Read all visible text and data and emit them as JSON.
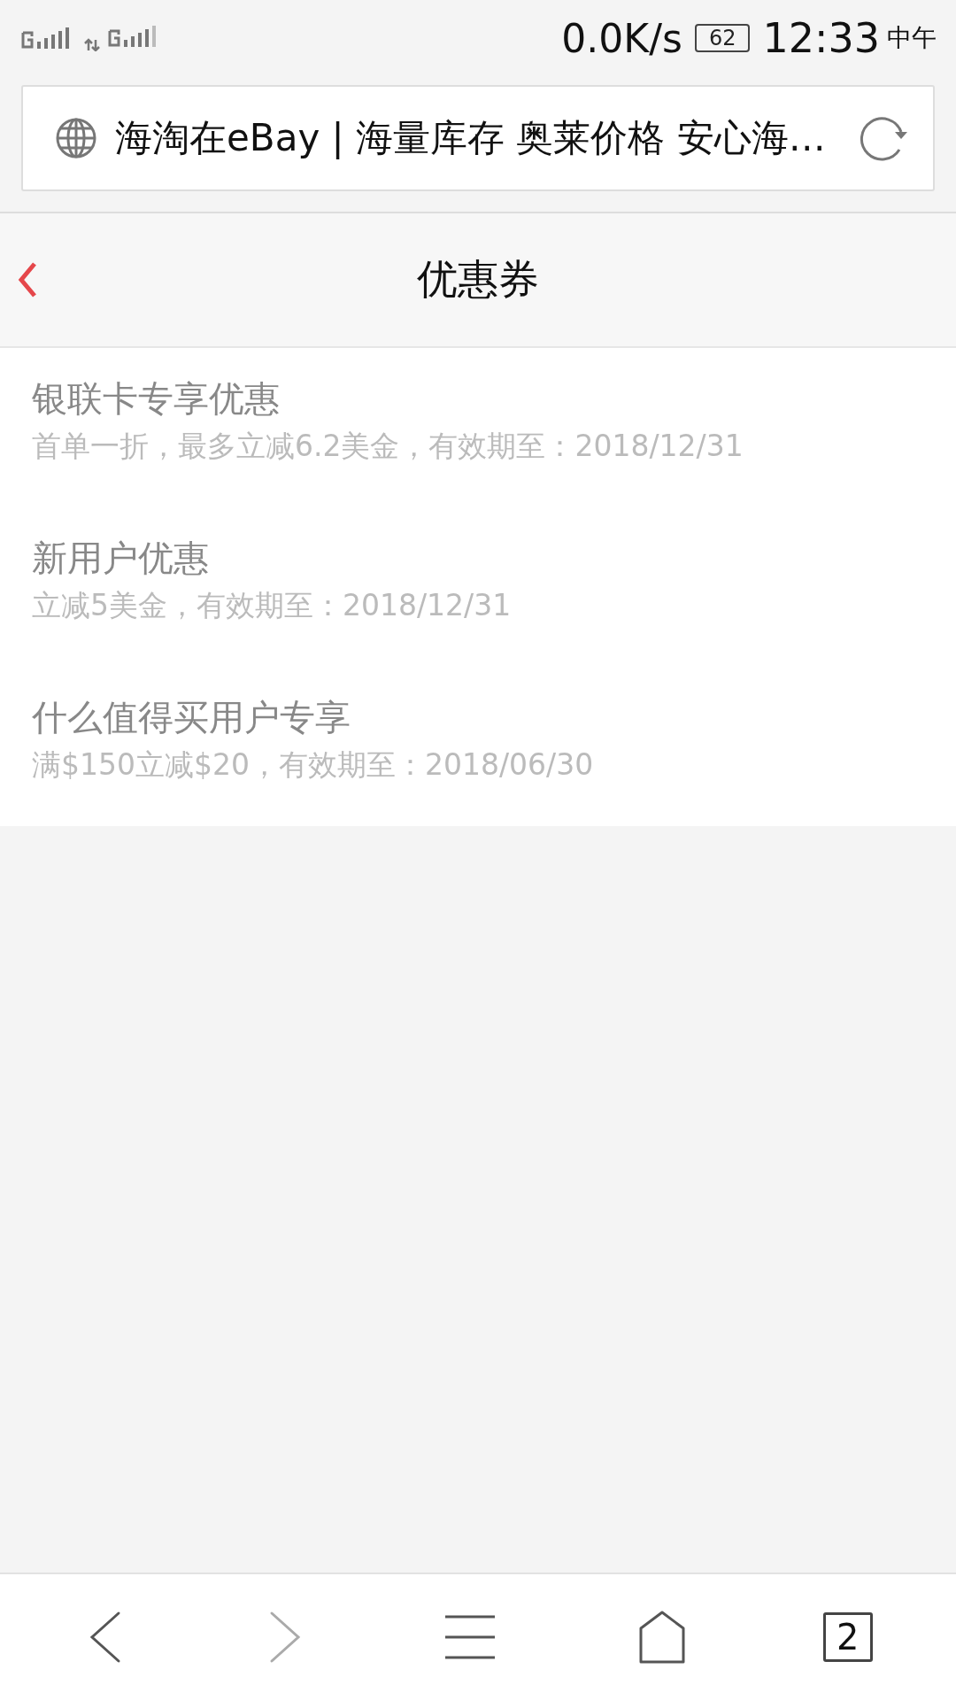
{
  "status_bar": {
    "network_speed": "0.0K/s",
    "battery": "62",
    "time": "12:33",
    "period": "中午"
  },
  "address_bar": {
    "title": "海淘在eBay | 海量库存 奥莱价格 安心海…"
  },
  "header": {
    "title": "优惠券"
  },
  "coupons": [
    {
      "name": "银联卡专享优惠",
      "detail": "首单一折，最多立减6.2美金，有效期至：2018/12/31"
    },
    {
      "name": "新用户优惠",
      "detail": "立减5美金，有效期至：2018/12/31"
    },
    {
      "name": "什么值得买用户专享",
      "detail": "满$150立减$20，有效期至：2018/06/30"
    }
  ],
  "bottom_nav": {
    "back_disabled": false,
    "forward_disabled": true,
    "tab_count": "2"
  }
}
